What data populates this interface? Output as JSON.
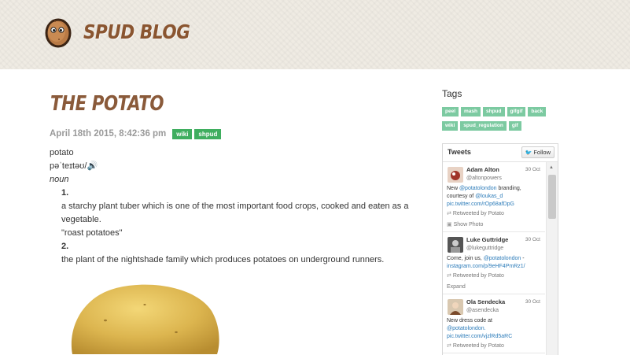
{
  "site": {
    "title": "SPUD BLOG"
  },
  "post": {
    "title": "THE POTATO",
    "date": "April 18th 2015, 8:42:36 pm",
    "tags": [
      "wiki",
      "shpud"
    ],
    "word": "potato",
    "pronunciation": "pəˈteɪtəʊ/🔊",
    "part_of_speech": "noun",
    "definitions": [
      {
        "number": "1.",
        "text": "a starchy plant tuber which is one of the most important food crops, cooked and eaten as a vegetable.",
        "example": "\"roast potatoes\""
      },
      {
        "number": "2.",
        "text": "the plant of the nightshade family which produces potatoes on underground runners."
      }
    ]
  },
  "sidebar": {
    "tags_title": "Tags",
    "tags": [
      "peel",
      "mash",
      "shpud",
      "gifgif",
      "back",
      "wiki",
      "spud_regulation",
      "gif"
    ],
    "tweets": {
      "title": "Tweets",
      "follow_label": "Follow",
      "items": [
        {
          "name": "Adam Alton",
          "handle": "@altonpowers",
          "date": "30 Oct",
          "text_prefix": "New ",
          "mention1": "@potatolondon",
          "text_mid": " branding, courtesy of ",
          "mention2": "@loukas_d",
          "link": "pic.twitter.com/rOp68afDpG",
          "retweeted": "Retweeted by Potato",
          "action": "Show Photo"
        },
        {
          "name": "Luke Guttridge",
          "handle": "@lukeguttridge",
          "date": "30 Oct",
          "text_prefix": "Come, join us, ",
          "mention1": "@potatolondon",
          "text_mid": " - ",
          "link": "instagram.com/p/9eHF4PmRz1/",
          "retweeted": "Retweeted by Potato",
          "action": "Expand"
        },
        {
          "name": "Ola Sendecka",
          "handle": "@asendecka",
          "date": "30 Oct",
          "text_prefix": "New dress code at ",
          "mention1": "@potatolondon.",
          "link": "pic.twitter.com/vjzlRd5aRC",
          "retweeted": "Retweeted by Potato"
        }
      ]
    }
  },
  "colors": {
    "header_bg": "#efebe3",
    "brand_brown": "#8a5530",
    "tag_green": "#3fae5f",
    "tag_light_green": "#7ccaa1",
    "link_blue": "#2b7bb9"
  },
  "icons": [
    "potato-logo-icon",
    "twitter-bird-icon",
    "retweet-icon",
    "photo-icon",
    "scroll-up-arrow-icon"
  ]
}
